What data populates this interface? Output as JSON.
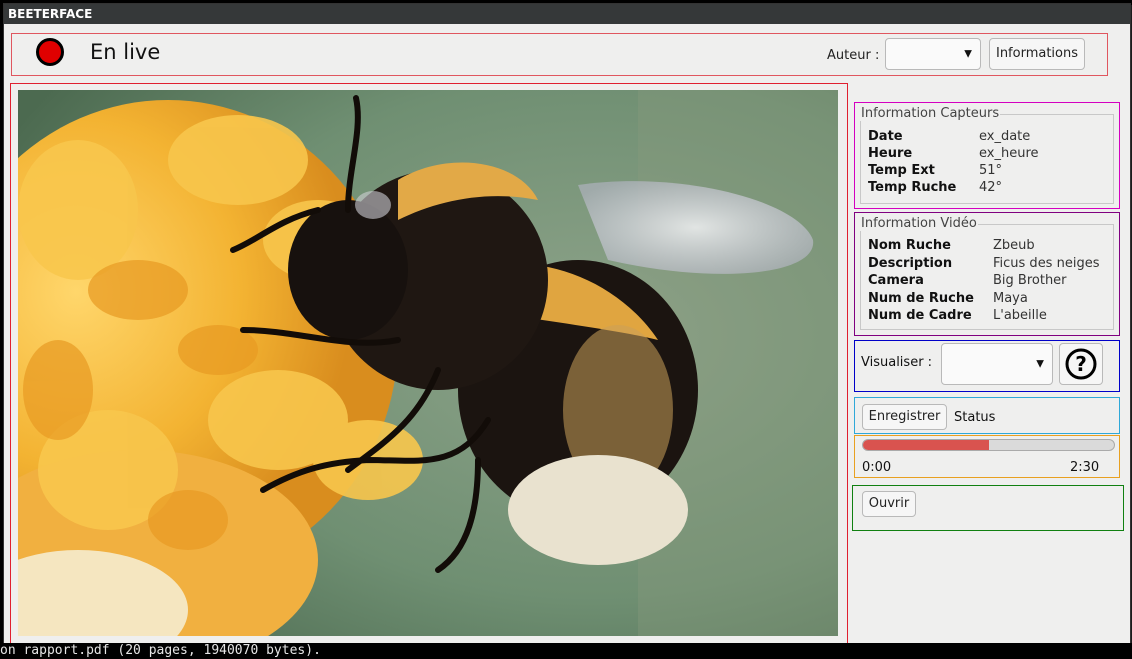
{
  "terminal": {
    "bottom_text": "on rapport.pdf (20 pages, 1940070 bytes)."
  },
  "window": {
    "title": "BEETERFACE"
  },
  "header": {
    "live_label": "En live",
    "author_label": "Auteur :",
    "author_value": "",
    "info_button": "Informations"
  },
  "sensors": {
    "title": "Information Capteurs",
    "rows": [
      {
        "label": "Date",
        "value": "ex_date"
      },
      {
        "label": "Heure",
        "value": "ex_heure"
      },
      {
        "label": "Temp Ext",
        "value": "51°"
      },
      {
        "label": "Temp Ruche",
        "value": "42°"
      }
    ]
  },
  "video_info": {
    "title": "Information Vidéo",
    "rows": [
      {
        "label": "Nom Ruche",
        "value": "Zbeub"
      },
      {
        "label": "Description",
        "value": "Ficus des neiges"
      },
      {
        "label": "Camera",
        "value": "Big Brother"
      },
      {
        "label": "Num de Ruche",
        "value": "Maya"
      },
      {
        "label": "Num de Cadre",
        "value": "L'abeille"
      }
    ]
  },
  "visualiser": {
    "label": "Visualiser :",
    "value": "",
    "help_icon": "question-circle-icon"
  },
  "record": {
    "button": "Enregistrer",
    "status": "Status"
  },
  "progress": {
    "fraction": 0.5,
    "start_time": "0:00",
    "end_time": "2:30",
    "bar_color": "#d9534f"
  },
  "open": {
    "button": "Ouvrir"
  },
  "colors": {
    "topbar_border": "#e0565f",
    "video_border": "#e02030",
    "sensors_border": "#d400c0",
    "video_info_border": "#800080",
    "visualiser_border": "#0000c8",
    "record_border": "#2fa8d8",
    "progress_border": "#e8a020",
    "open_border": "#108010"
  }
}
